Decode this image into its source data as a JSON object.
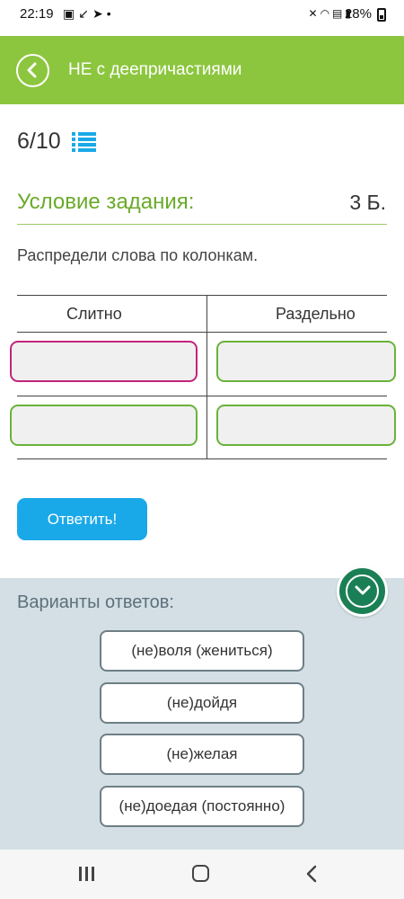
{
  "status_bar": {
    "time": "22:19",
    "left_icons": [
      "gallery-icon",
      "missed-call-icon",
      "telegram-icon",
      "dot-icon"
    ],
    "right_icons": [
      "mute-icon",
      "wifi-icon",
      "volte-icon",
      "signal-icon"
    ],
    "battery": "28%"
  },
  "header": {
    "title": "НЕ с деепричастиями",
    "back_icon": "arrow-left-icon",
    "color": "#8cc63e"
  },
  "progress": {
    "text": "6/10",
    "icon": "list-icon"
  },
  "condition": {
    "title": "Условие задания:",
    "points": "3 Б.",
    "text": "Распредели слова по колонкам."
  },
  "table": {
    "columns": [
      "Слитно",
      "Раздельно"
    ]
  },
  "answer_button": {
    "label": "Ответить!",
    "color": "#1aa9e8"
  },
  "variants": {
    "title": "Варианты ответов:",
    "items": [
      "(не)воля (жениться)",
      "(не)дойдя",
      "(не)желая",
      "(не)доедая (постоянно)"
    ]
  },
  "nav": {
    "icons": [
      "recent-apps-icon",
      "home-icon",
      "back-icon"
    ]
  }
}
